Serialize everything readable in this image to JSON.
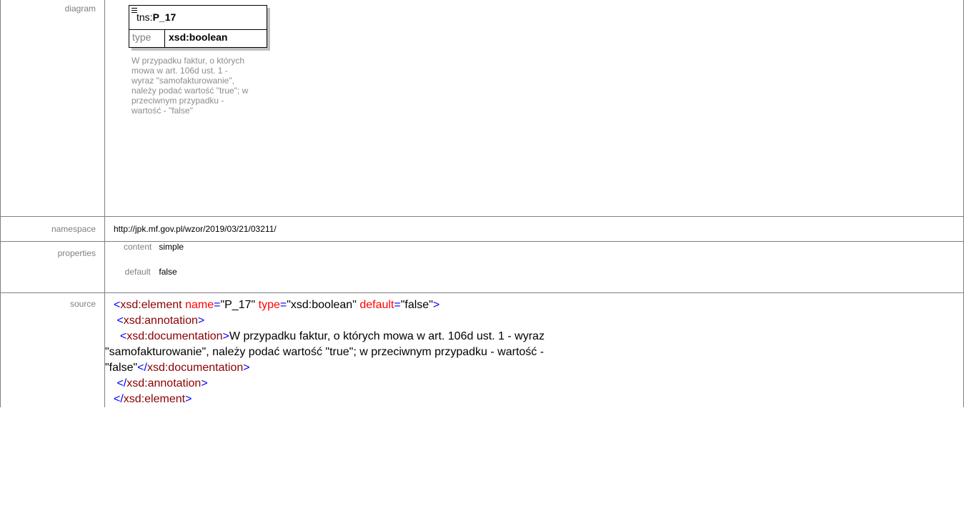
{
  "labels": {
    "diagram": "diagram",
    "namespace": "namespace",
    "properties": "properties",
    "source": "source"
  },
  "diagram": {
    "prefix": "tns:",
    "name": "P_17",
    "type_key": "type",
    "type_value": "xsd:boolean",
    "documentation": "W przypadku faktur, o których\nmowa w art. 106d ust. 1 -\nwyraz \"samofakturowanie\",\nnależy podać wartość \"true\"; w\nprzeciwnym przypadku -\nwartość - \"false\""
  },
  "namespace": "http://jpk.mf.gov.pl/wzor/2019/03/21/03211/",
  "properties": [
    {
      "key": "content",
      "value": "simple"
    },
    {
      "key": "default",
      "value": "false"
    }
  ],
  "source": {
    "line1": {
      "open": "<",
      "tag": "xsd:element",
      "attr1": "name",
      "val1": "\"P_17\"",
      "attr2": "type",
      "val2": "\"xsd:boolean\"",
      "attr3": "default",
      "val3": "\"false\"",
      "close": ">"
    },
    "annotation_open": "xsd:annotation",
    "documentation_tag": "xsd:documentation",
    "doc_text_1": "W przypadku faktur, o których mowa w art. 106d ust. 1 - wyraz",
    "doc_text_2": "\"samofakturowanie\", należy podać wartość \"true\"; w przeciwnym przypadku - wartość -",
    "doc_text_3": "\"false\"",
    "documentation_close": "xsd:documentation",
    "annotation_close": "xsd:annotation",
    "element_close": "xsd:element"
  },
  "colors": {
    "tag": "#8b0000",
    "bracket": "#0000ff",
    "attribute": "#ff0000",
    "label": "#808080",
    "border": "#7f7f7f"
  }
}
